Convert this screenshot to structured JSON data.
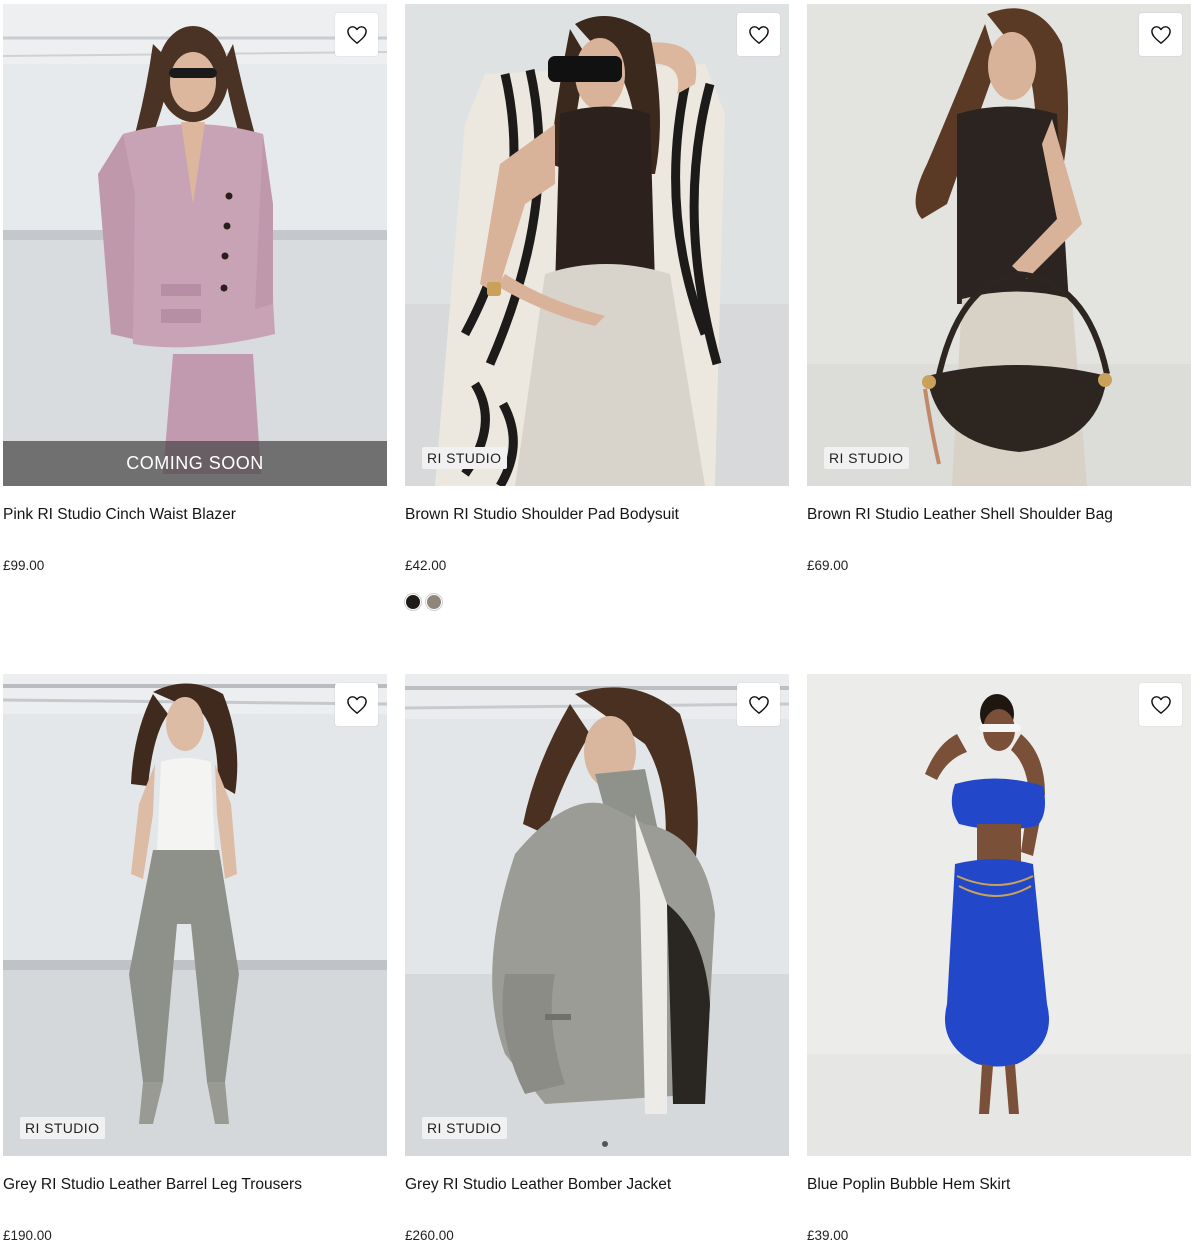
{
  "products": [
    {
      "name": "Pink RI Studio Cinch Waist Blazer",
      "price": "£99.00",
      "overlay": "COMING SOON",
      "badge": "",
      "wishlist_icon": "heart-outline-icon",
      "photo_palette": {
        "backdrop": "#e7eaec",
        "floor": "#d9dcdf",
        "garment": "#c8a3b6",
        "hair": "#4a3324"
      }
    },
    {
      "name": "Brown RI Studio Shoulder Pad Bodysuit",
      "price": "£42.00",
      "overlay": "",
      "badge": "RI STUDIO",
      "wishlist_icon": "heart-outline-icon",
      "swatches": [
        {
          "label": "black",
          "color": "#1e1b18"
        },
        {
          "label": "taupe",
          "color": "#8f857b"
        }
      ],
      "photo_palette": {
        "backdrop": "#dfe2e3",
        "floor": "#d7d9da",
        "garment": "#2c211c",
        "skirt": "#d9d4cb",
        "hair": "#3b291d"
      }
    },
    {
      "name": "Brown RI Studio Leather Shell Shoulder Bag",
      "price": "£69.00",
      "overlay": "",
      "badge": "RI STUDIO",
      "wishlist_icon": "heart-outline-icon",
      "photo_palette": {
        "backdrop": "#e3e4e0",
        "floor": "#dcddd8",
        "garment": "#2b2420",
        "skirt": "#d8d2c6",
        "bag": "#2d2520",
        "hair": "#5a3a25"
      }
    },
    {
      "name": "Grey RI Studio Leather Barrel Leg Trousers",
      "price": "£190.00",
      "overlay": "",
      "badge": "RI STUDIO",
      "wishlist_icon": "heart-outline-icon",
      "photo_palette": {
        "backdrop": "#e4e7ea",
        "floor": "#d5d8db",
        "garment": "#8e918a",
        "top": "#f4f4f2",
        "hair": "#3f2a1d"
      }
    },
    {
      "name": "Grey RI Studio Leather Bomber Jacket",
      "price": "£260.00",
      "overlay": "",
      "badge": "RI STUDIO",
      "wishlist_icon": "heart-outline-icon",
      "photo_palette": {
        "backdrop": "#e3e6e8",
        "floor": "#d6d9dc",
        "garment": "#9a9c95",
        "hair": "#4a3020"
      }
    },
    {
      "name": "Blue Poplin Bubble Hem Skirt",
      "price": "£39.00",
      "overlay": "",
      "badge": "",
      "wishlist_icon": "heart-outline-icon",
      "photo_palette": {
        "backdrop": "#ececeb",
        "floor": "#e6e6e5",
        "garment": "#2248c9",
        "skin": "#7a5038",
        "hair": "#1f1611"
      }
    }
  ]
}
